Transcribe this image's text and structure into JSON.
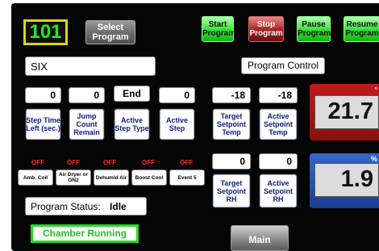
{
  "program_number": "101",
  "select_program_label": "Select Program",
  "buttons": {
    "start": "Start Program",
    "stop": "Stop Program",
    "pause": "Pause Program",
    "resume": "Resume Program"
  },
  "program_name": "SIX",
  "program_control_label": "Program Control",
  "counters": [
    {
      "value": "0",
      "label": "Step Time Left (sec.)"
    },
    {
      "value": "0",
      "label": "Jump Count Remain"
    },
    {
      "value": "End",
      "label": "Active Step Type"
    },
    {
      "value": "0",
      "label": "Active Step"
    }
  ],
  "setpoints": {
    "target_temp": {
      "value": "-18",
      "label": "Target Setpoint Temp"
    },
    "active_temp": {
      "value": "-18",
      "label": "Active Setpoint Temp"
    },
    "target_rh": {
      "value": "0",
      "label": "Target Setpoint RH"
    },
    "active_rh": {
      "value": "0",
      "label": "Active Setpoint RH"
    }
  },
  "readings": {
    "temperature": "21.7",
    "humidity": "1.9",
    "temp_unit": "°",
    "rh_unit": "%"
  },
  "events": [
    {
      "state": "OFF",
      "label": "Amb. Coil"
    },
    {
      "state": "OFF",
      "label": "Air Dryer or GN2"
    },
    {
      "state": "OFF",
      "label": "Dehumid Air"
    },
    {
      "state": "OFF",
      "label": "Boost Cool"
    },
    {
      "state": "OFF",
      "label": "Event 5"
    }
  ],
  "program_status": {
    "label": "Program Status:",
    "value": "Idle"
  },
  "chamber_status": "Chamber Running",
  "main_label": "Main",
  "colors": {
    "panel": "#050505",
    "program_number": "#25e825",
    "start_pause_resume": "#2fe02f",
    "stop": "#a02020",
    "temp_readout_bg": "#c31b1b",
    "rh_readout_bg": "#3767c8",
    "off_indicator": "#ff2a2a",
    "label_text": "#102080"
  }
}
